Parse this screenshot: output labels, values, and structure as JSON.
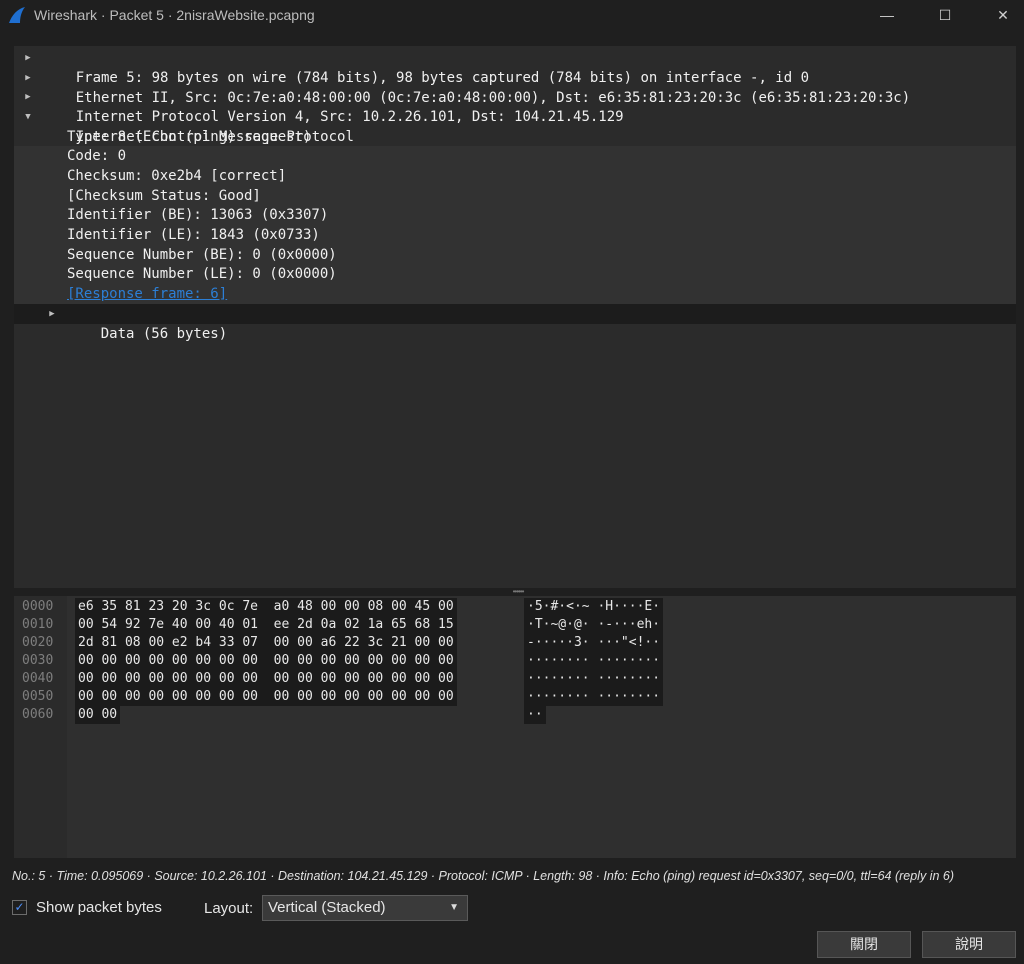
{
  "window": {
    "title": "Wireshark · Packet 5 · 2nisraWebsite.pcapng",
    "controls": {
      "minimize": "—",
      "maximize": "☐",
      "close": "✕"
    }
  },
  "tree": {
    "frame": "Frame 5: 98 bytes on wire (784 bits), 98 bytes captured (784 bits) on interface -, id 0",
    "ethernet": "Ethernet II, Src: 0c:7e:a0:48:00:00 (0c:7e:a0:48:00:00), Dst: e6:35:81:23:20:3c (e6:35:81:23:20:3c)",
    "ipv4": "Internet Protocol Version 4, Src: 10.2.26.101, Dst: 104.21.45.129",
    "icmp": "Internet Control Message Protocol",
    "icmp_fields": [
      "Type: 8 (Echo (ping) request)",
      "Code: 0",
      "Checksum: 0xe2b4 [correct]",
      "[Checksum Status: Good]",
      "Identifier (BE): 13063 (0x3307)",
      "Identifier (LE): 1843 (0x0733)",
      "Sequence Number (BE): 0 (0x0000)",
      "Sequence Number (LE): 0 (0x0000)"
    ],
    "response_link": "[Response frame: 6]",
    "data": "Data (56 bytes)"
  },
  "bytes": {
    "rows": [
      {
        "offset": "0000",
        "hex": "e6 35 81 23 20 3c 0c 7e  a0 48 00 00 08 00 45 00",
        "ascii": "·5·#·<·~ ·H····E·"
      },
      {
        "offset": "0010",
        "hex": "00 54 92 7e 40 00 40 01  ee 2d 0a 02 1a 65 68 15",
        "ascii": "·T·~@·@· ·-···eh·"
      },
      {
        "offset": "0020",
        "hex": "2d 81 08 00 e2 b4 33 07  00 00 a6 22 3c 21 00 00",
        "ascii": "-·····3· ···\"<!··"
      },
      {
        "offset": "0030",
        "hex": "00 00 00 00 00 00 00 00  00 00 00 00 00 00 00 00",
        "ascii": "········ ········"
      },
      {
        "offset": "0040",
        "hex": "00 00 00 00 00 00 00 00  00 00 00 00 00 00 00 00",
        "ascii": "········ ········"
      },
      {
        "offset": "0050",
        "hex": "00 00 00 00 00 00 00 00  00 00 00 00 00 00 00 00",
        "ascii": "········ ········"
      },
      {
        "offset": "0060",
        "hex": "00 00",
        "ascii": "··"
      }
    ]
  },
  "status": "No.: 5 · Time: 0.095069 · Source: 10.2.26.101 · Destination: 104.21.45.129 · Protocol: ICMP · Length: 98 · Info: Echo (ping) request id=0x3307, seq=0/0, ttl=64 (reply in 6)",
  "controls": {
    "show_bytes_label": "Show packet bytes",
    "show_bytes_checked": true,
    "layout_label": "Layout:",
    "layout_value": "Vertical (Stacked)",
    "close_button": "關閉",
    "help_button": "說明"
  }
}
